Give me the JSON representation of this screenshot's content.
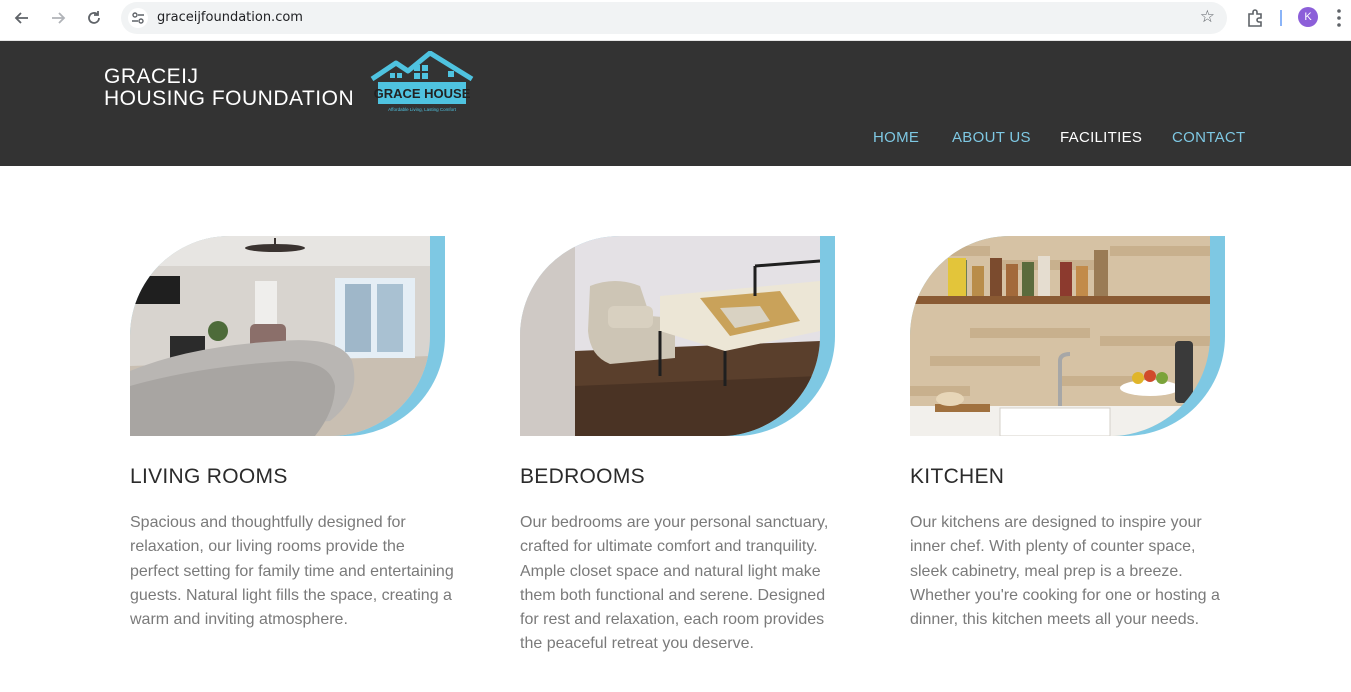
{
  "browser": {
    "url": "graceijfoundation.com",
    "profile_initial": "K",
    "icons": [
      "back-icon",
      "forward-icon",
      "reload-icon",
      "site-info-icon",
      "star-icon",
      "extensions-icon",
      "more-icon"
    ]
  },
  "site": {
    "brand_line1": "GRACEIJ",
    "brand_line2": "HOUSING FOUNDATION",
    "logo_text": "GRACE HOUSE",
    "logo_tagline": "Affordable Living, Lasting Comfort",
    "accent_color": "#7ec8e3",
    "header_color": "#333333"
  },
  "nav": {
    "items": [
      {
        "label": "HOME",
        "active": false
      },
      {
        "label": "ABOUT US",
        "active": false
      },
      {
        "label": "FACILITIES",
        "active": true
      },
      {
        "label": "CONTACT",
        "active": false
      }
    ]
  },
  "facilities": [
    {
      "title": "LIVING ROOMS",
      "text": "Spacious and thoughtfully designed for relaxation, our living rooms provide the perfect setting for family time and entertaining guests. Natural light fills the space, creating a warm and inviting atmosphere."
    },
    {
      "title": "BEDROOMS",
      "text": "Our bedrooms are your personal sanctuary, crafted for ultimate comfort and tranquility. Ample closet space and natural light make them both functional and serene. Designed for rest and relaxation, each room provides the peaceful retreat you deserve."
    },
    {
      "title": "KITCHEN",
      "text": "Our kitchens are designed to inspire your inner chef. With plenty of counter space, sleek cabinetry, meal prep is a breeze. Whether you're cooking for one or hosting a dinner, this kitchen meets all your needs."
    }
  ]
}
